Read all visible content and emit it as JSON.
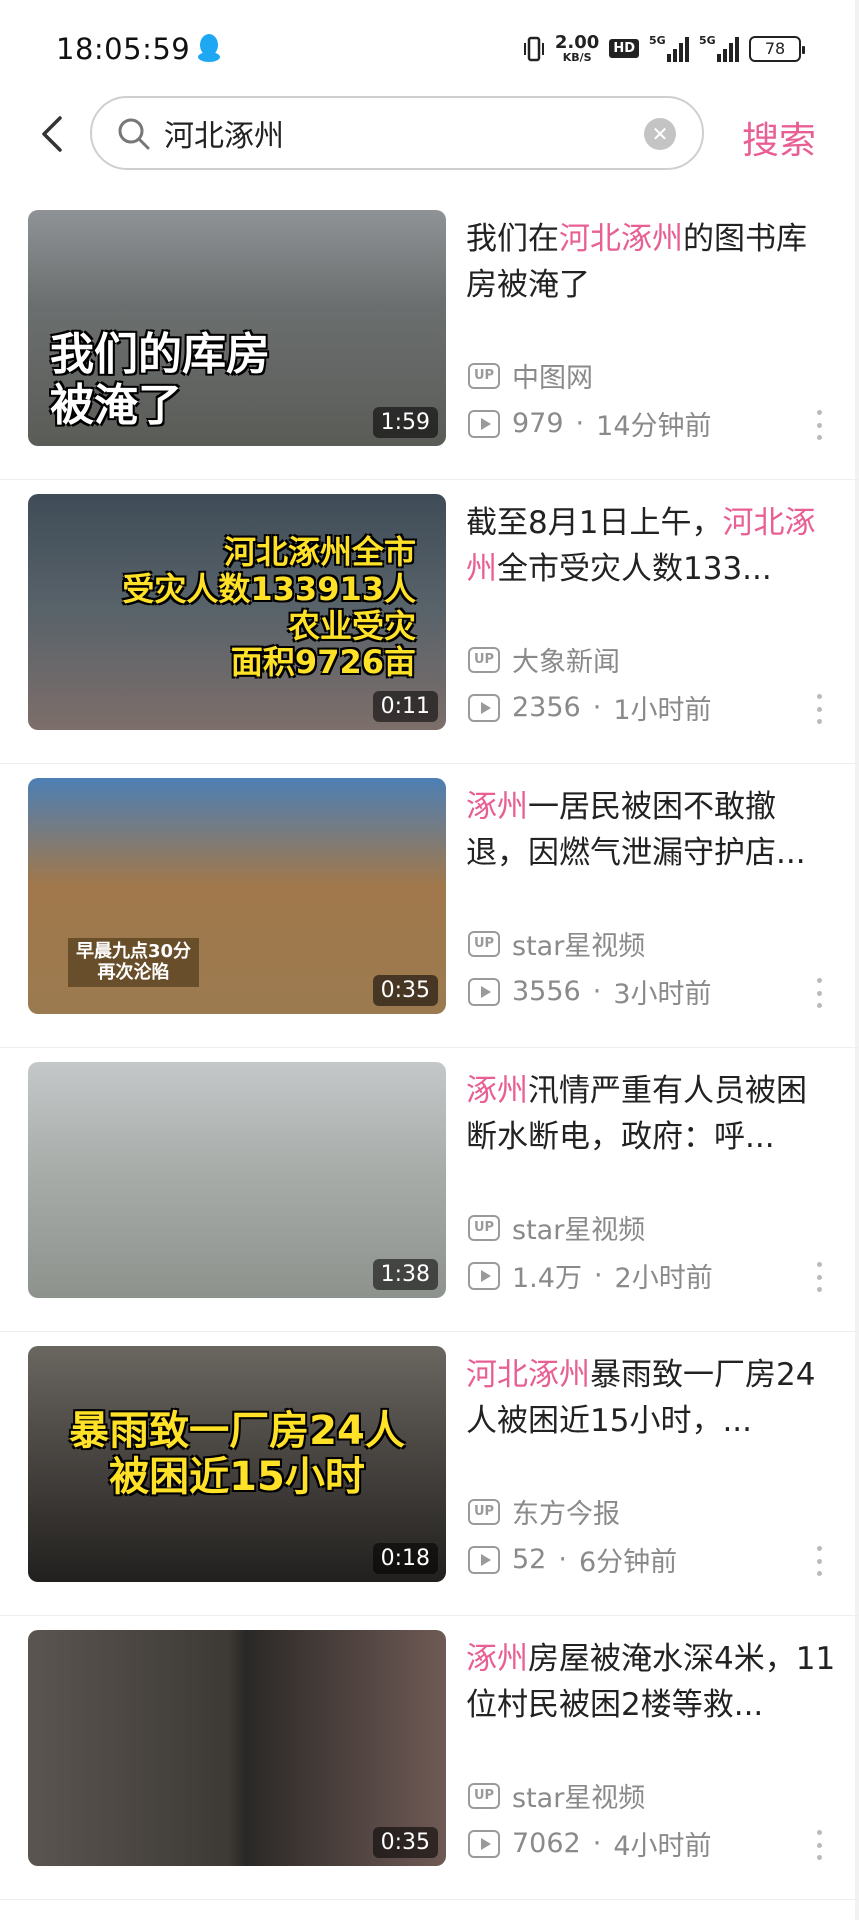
{
  "status": {
    "time": "18:05:59",
    "speed_value": "2.00",
    "speed_unit": "KB/S",
    "hd_label": "HD",
    "signal1_label": "5G",
    "signal2_label": "5G",
    "battery": "78"
  },
  "search": {
    "query": "河北涿州",
    "button_label": "搜索"
  },
  "results": [
    {
      "thumb_text": "我们的库房\n被淹了",
      "duration": "1:59",
      "title_parts": [
        {
          "t": "我们在"
        },
        {
          "t": "河北涿州",
          "hl": true
        },
        {
          "t": "的图书库房被淹了"
        }
      ],
      "uploader": "中图网",
      "views": "979",
      "time_ago": "14分钟前"
    },
    {
      "thumb_text": "河北涿州全市\n受灾人数133913人\n农业受灾\n面积9726亩",
      "duration": "0:11",
      "title_parts": [
        {
          "t": "截至8月1日上午，"
        },
        {
          "t": "河北涿州",
          "hl": true
        },
        {
          "t": "全市受灾人数133..."
        }
      ],
      "uploader": "大象新闻",
      "views": "2356",
      "time_ago": "1小时前"
    },
    {
      "thumb_text": "早晨九点30分\n再次沦陷",
      "duration": "0:35",
      "title_parts": [
        {
          "t": "涿州",
          "hl": true
        },
        {
          "t": "一居民被困不敢撤退，因燃气泄漏守护店..."
        }
      ],
      "uploader": "star星视频",
      "views": "3556",
      "time_ago": "3小时前"
    },
    {
      "thumb_text": "",
      "duration": "1:38",
      "title_parts": [
        {
          "t": "涿州",
          "hl": true
        },
        {
          "t": "汛情严重有人员被困断水断电，政府：呼..."
        }
      ],
      "uploader": "star星视频",
      "views": "1.4万",
      "time_ago": "2小时前"
    },
    {
      "thumb_text": "暴雨致一厂房24人\n被困近15小时",
      "duration": "0:18",
      "title_parts": [
        {
          "t": "河北涿州",
          "hl": true
        },
        {
          "t": "暴雨致一厂房24人被困近15小时，..."
        }
      ],
      "uploader": "东方今报",
      "views": "52",
      "time_ago": "6分钟前"
    },
    {
      "thumb_text": "",
      "duration": "0:35",
      "title_parts": [
        {
          "t": "涿州",
          "hl": true
        },
        {
          "t": "房屋被淹水深4米，11位村民被困2楼等救..."
        }
      ],
      "uploader": "star星视频",
      "views": "7062",
      "time_ago": "4小时前"
    }
  ],
  "badges": {
    "up": "UP"
  },
  "colors": {
    "accent": "#e85f94"
  }
}
